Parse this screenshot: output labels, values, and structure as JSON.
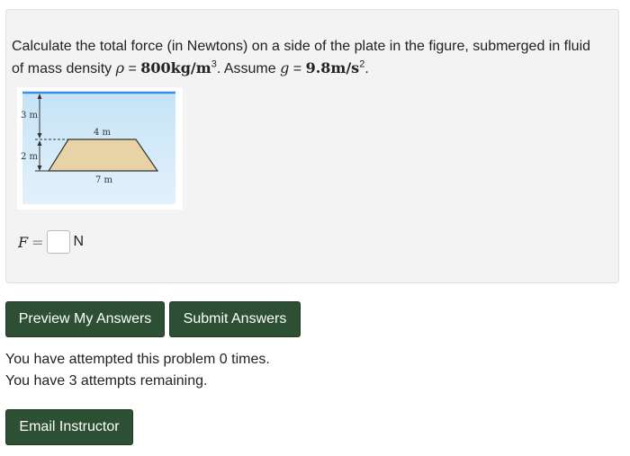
{
  "problem": {
    "text_part1": "Calculate the total force (in Newtons) on a side of the plate in the figure, submerged in fluid of mass density ",
    "rho_symbol": "ρ",
    "equals": " = ",
    "rho_value": "800kg/m",
    "rho_exp": "3",
    "text_part2": ". Assume ",
    "g_symbol": "g",
    "g_value": "9.8m/s",
    "g_exp": "2",
    "end": "."
  },
  "figure": {
    "label_depth_top": "3 m",
    "label_height": "2 m",
    "label_top_width": "4 m",
    "label_bottom_width": "7 m"
  },
  "answer": {
    "var": "F",
    "eq": "=",
    "unit": "N",
    "value": ""
  },
  "buttons": {
    "preview": "Preview My Answers",
    "submit": "Submit Answers",
    "email": "Email Instructor"
  },
  "status": {
    "attempts": "You have attempted this problem 0 times.",
    "remaining": "You have 3 attempts remaining."
  }
}
